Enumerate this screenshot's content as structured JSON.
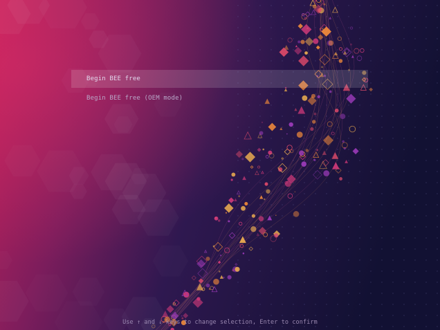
{
  "boot_menu": {
    "entries": [
      {
        "label": "Begin BEE free",
        "selected": true
      },
      {
        "label": "Begin BEE free (OEM mode)",
        "selected": false
      }
    ]
  },
  "footer": {
    "hint": "Use ↑ and ↓ keys to change selection, Enter to confirm"
  },
  "colors": {
    "background_left": "#c0245a",
    "background_mid": "#3a1a54",
    "background_right": "#141233",
    "highlight": "#ffffff24",
    "accent_orange": "#f08a3a",
    "accent_magenta": "#d33a7a"
  }
}
